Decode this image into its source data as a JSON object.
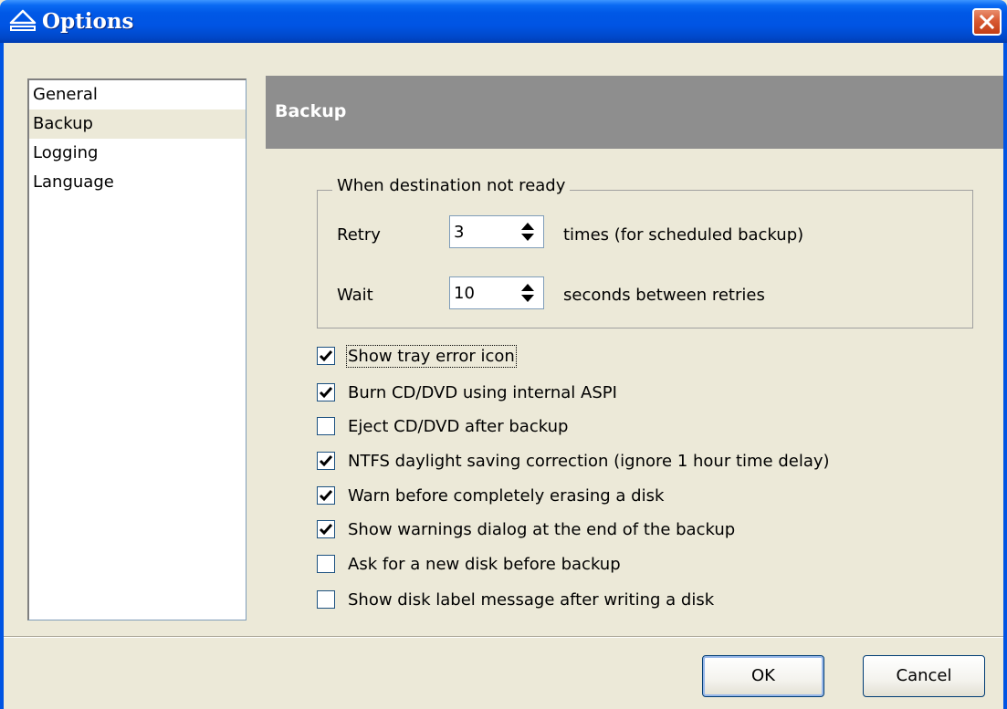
{
  "window": {
    "title": "Options"
  },
  "nav": {
    "items": [
      "General",
      "Backup",
      "Logging",
      "Language"
    ],
    "selected": "Backup"
  },
  "header": {
    "title": "Backup"
  },
  "destination_group": {
    "legend": "When destination not ready",
    "retry": {
      "label": "Retry",
      "value": "3",
      "suffix": "times (for scheduled backup)"
    },
    "wait": {
      "label": "Wait",
      "value": "10",
      "suffix": "seconds between retries"
    }
  },
  "options": [
    {
      "label": "Show tray error icon",
      "checked": true
    },
    {
      "label": "Burn CD/DVD using internal ASPI",
      "checked": true
    },
    {
      "label": "Eject CD/DVD after backup",
      "checked": false
    },
    {
      "label": "NTFS daylight saving correction (ignore 1 hour time delay)",
      "checked": true
    },
    {
      "label": "Warn before completely erasing a disk",
      "checked": true
    },
    {
      "label": "Show warnings dialog at the end of the backup",
      "checked": true
    },
    {
      "label": "Ask for a new disk before backup",
      "checked": false
    },
    {
      "label": "Show disk label message after writing a disk",
      "checked": false
    }
  ],
  "buttons": {
    "ok": "OK",
    "cancel": "Cancel"
  },
  "colors": {
    "titlebar": "#0054e3",
    "header_band": "#8e8e8e",
    "dialog_bg": "#ece9d8",
    "close_button": "#d85a33"
  }
}
